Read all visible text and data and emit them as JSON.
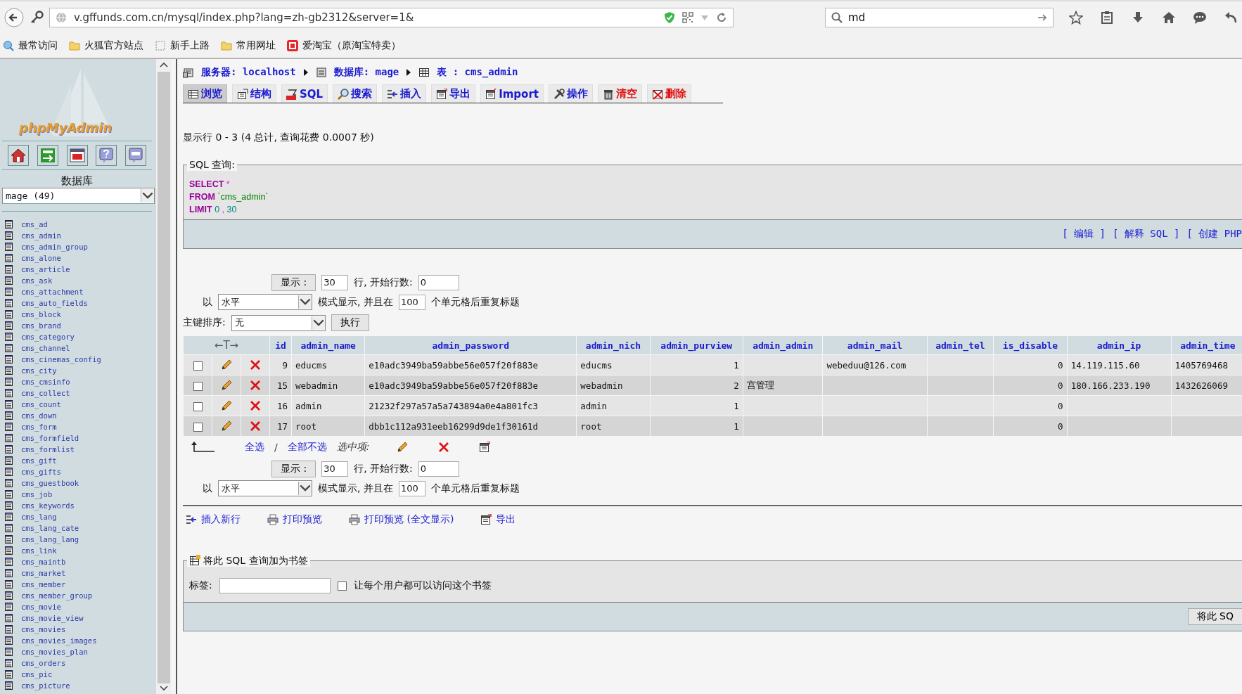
{
  "browser": {
    "url": "v.gffunds.com.cn/mysql/index.php?lang=zh-gb2312&server=1&",
    "search": "md",
    "bookmarks": [
      {
        "label": "最常访问",
        "kind": "feed"
      },
      {
        "label": "火狐官方站点",
        "kind": "folder"
      },
      {
        "label": "新手上路",
        "kind": "page"
      },
      {
        "label": "常用网址",
        "kind": "folder"
      },
      {
        "label": "爱淘宝（原淘宝特卖）",
        "kind": "taobao"
      }
    ]
  },
  "sidebar": {
    "logo": "phpMyAdmin",
    "db_label": "数据库",
    "db_select": "mage (49)",
    "tables": [
      "cms_ad",
      "cms_admin",
      "cms_admin_group",
      "cms_alone",
      "cms_article",
      "cms_ask",
      "cms_attachment",
      "cms_auto_fields",
      "cms_block",
      "cms_brand",
      "cms_category",
      "cms_channel",
      "cms_cinemas_config",
      "cms_city",
      "cms_cmsinfo",
      "cms_collect",
      "cms_count",
      "cms_down",
      "cms_form",
      "cms_formfield",
      "cms_formlist",
      "cms_gift",
      "cms_gifts",
      "cms_guestbook",
      "cms_job",
      "cms_keywords",
      "cms_lang",
      "cms_lang_cate",
      "cms_lang_lang",
      "cms_link",
      "cms_maintb",
      "cms_market",
      "cms_member",
      "cms_member_group",
      "cms_movie",
      "cms_movie_view",
      "cms_movies",
      "cms_movies_images",
      "cms_movies_plan",
      "cms_orders",
      "cms_pic",
      "cms_picture"
    ]
  },
  "breadcrumb": [
    {
      "kind": "server",
      "label": "服务器:",
      "value": "localhost"
    },
    {
      "kind": "database",
      "label": "数据库:",
      "value": "mage"
    },
    {
      "kind": "table",
      "label": "表 :",
      "value": "cms_admin"
    }
  ],
  "tabs": [
    {
      "label": "浏览",
      "kind": "browse",
      "selected": true
    },
    {
      "label": "结构",
      "kind": "structure",
      "selected": false
    },
    {
      "label": "SQL",
      "kind": "sql",
      "selected": false
    },
    {
      "label": "搜索",
      "kind": "search",
      "selected": false
    },
    {
      "label": "插入",
      "kind": "insert",
      "selected": false
    },
    {
      "label": "导出",
      "kind": "export",
      "selected": false
    },
    {
      "label": "Import",
      "kind": "import",
      "selected": false
    },
    {
      "label": "操作",
      "kind": "operations",
      "selected": false
    },
    {
      "label": "清空",
      "kind": "empty",
      "selected": false
    },
    {
      "label": "删除",
      "kind": "drop",
      "selected": false
    }
  ],
  "info": "显示行 0 - 3 (4 总计, 查询花费 0.0007 秒)",
  "sql_box": {
    "legend": "SQL 查询:",
    "lines": [
      [
        {
          "kind": "keyword",
          "text": "SELECT"
        },
        {
          "kind": "punct",
          "text": "*"
        }
      ],
      [
        {
          "kind": "keyword",
          "text": "FROM"
        },
        {
          "kind": "name",
          "text": "`cms_admin`"
        }
      ],
      [
        {
          "kind": "keyword",
          "text": "LIMIT"
        },
        {
          "kind": "number",
          "text": "0"
        },
        {
          "kind": "punct",
          "text": ","
        },
        {
          "kind": "number",
          "text": "30"
        }
      ]
    ],
    "links": [
      "[ 编辑 ]",
      "[ 解释 SQL ]",
      "[ 创建 PHP"
    ]
  },
  "nav_forms": [
    {
      "show_button": "显示 :",
      "rows": "30",
      "rows_label": "行, 开始行数:",
      "start": "0",
      "mode_prefix": "以",
      "mode": "水平",
      "mode_label": "模式显示, 并且在",
      "repeat": "100",
      "repeat_label": "个单元格后重复标题"
    },
    {
      "show_button": "显示 :",
      "rows": "30",
      "rows_label": "行, 开始行数:",
      "start": "0",
      "mode_prefix": "以",
      "mode": "水平",
      "mode_label": "模式显示, 并且在",
      "repeat": "100",
      "repeat_label": "个单元格后重复标题"
    }
  ],
  "sort": {
    "label": "主键排序:",
    "value": "无",
    "button": "执行"
  },
  "table": {
    "arrows": "←T→",
    "columns": [
      {
        "label": "id",
        "kind": "number"
      },
      {
        "label": "admin_name",
        "kind": "text"
      },
      {
        "label": "admin_password",
        "kind": "text"
      },
      {
        "label": "admin_nich",
        "kind": "text"
      },
      {
        "label": "admin_purview",
        "kind": "number"
      },
      {
        "label": "admin_admin",
        "kind": "text"
      },
      {
        "label": "admin_mail",
        "kind": "text"
      },
      {
        "label": "admin_tel",
        "kind": "text"
      },
      {
        "label": "is_disable",
        "kind": "number"
      },
      {
        "label": "admin_ip",
        "kind": "text"
      },
      {
        "label": "admin_time",
        "kind": "text"
      }
    ],
    "rows": [
      {
        "checked": false,
        "cells": [
          "9",
          "educms",
          "e10adc3949ba59abbe56e057f20f883e",
          "educms",
          "1",
          null,
          "webeduu@126.com",
          null,
          "0",
          "14.119.115.60",
          "1405769468"
        ]
      },
      {
        "checked": false,
        "cells": [
          "15",
          "webadmin",
          "e10adc3949ba59abbe56e057f20f883e",
          "webadmin",
          "2",
          "宫管理",
          null,
          null,
          "0",
          "180.166.233.190",
          "1432626069"
        ]
      },
      {
        "checked": false,
        "cells": [
          "16",
          "admin",
          "21232f297a57a5a743894a0e4a801fc3",
          "admin",
          "1",
          null,
          null,
          null,
          "0",
          null,
          null
        ]
      },
      {
        "checked": false,
        "cells": [
          "17",
          "root",
          "dbb1c112a931eeb16299d9de1f30161d",
          "root",
          "1",
          null,
          null,
          null,
          "0",
          null,
          null
        ]
      }
    ],
    "check_all": "全选",
    "separator": "/",
    "uncheck_all": "全部不选",
    "with_selected": "选中项:"
  },
  "actions": [
    {
      "label": "插入新行",
      "kind": "insert"
    },
    {
      "label": "打印预览",
      "kind": "print"
    },
    {
      "label": "打印预览 (全文显示)",
      "kind": "print"
    },
    {
      "label": "导出",
      "kind": "export"
    }
  ],
  "bookmark": {
    "legend": "将此 SQL 查询加为书签",
    "label": "标签:",
    "public_checked": false,
    "public_label": "让每个用户都可以访问这个书签",
    "button": "将此 SQ"
  }
}
